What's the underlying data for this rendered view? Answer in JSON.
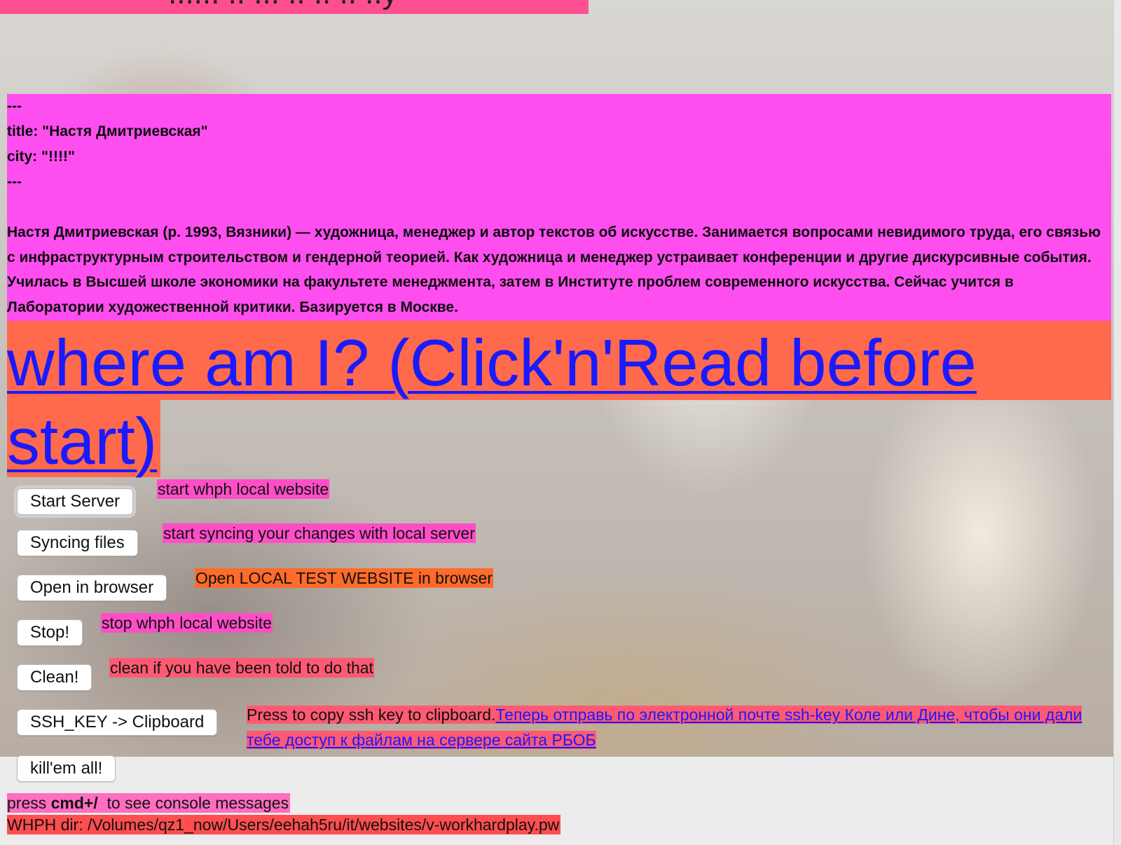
{
  "top_bar": {
    "partial_text": "...... .. ... .. .. .. ..y"
  },
  "frontmatter": {
    "separator_open": "---",
    "title_line": "title: \"Настя Дмитриевская\"",
    "city_line": "city: \"!!!!\"",
    "separator_close": "---",
    "bio": "Настя Дмитриевская (р. 1993, Вязники) — художница, менеджер и автор текстов об искусстве. Занимается вопросами невидимого труда, его связью с инфраструктурным строительством и гендерной теорией. Как художница и менеджер устраивает конференции и другие дискурсивные события. Училась в Высшей школе экономики на факультете менеджмента, затем в Институте проблем современного искусства. Сейчас учится в Лаборатории художественной критики. Базируется в Москве."
  },
  "headline": {
    "link_text": "where am I? (Click'n'Read before start)"
  },
  "actions": {
    "start_server": {
      "label": "Start Server",
      "description": "start whph local website"
    },
    "syncing_files": {
      "label": "Syncing files",
      "description": "start syncing your changes with local server"
    },
    "open_in_browser": {
      "label": "Open in browser",
      "description": "Open LOCAL TEST WEBSITE in browser"
    },
    "stop": {
      "label": "Stop!",
      "description": "stop whph local website"
    },
    "clean": {
      "label": "Clean!",
      "description": "clean if you have been told to do that"
    },
    "ssh_key": {
      "label": "SSH_KEY -> Clipboard",
      "description": "Press to copy ssh key to clipboard.",
      "link_text": "Теперь отправь по электронной почте ssh-key Коле или Дине, чтобы они дали тебе доступ к файлам на сервере сайта РБОБ"
    },
    "kill_all": {
      "label": "kill'em all!"
    }
  },
  "footer": {
    "hint_prefix": "press ",
    "hint_key": "cmd+/",
    "hint_suffix": "  to see console messages",
    "dir_label": "WHPH dir: /Volumes/qz1_now/Users/eehah5ru/it/websites/v-workhardplay.pw"
  },
  "colors": {
    "frontmatter_bg": "#ff4ef0",
    "headline_bg": "#ff6a4c",
    "link": "#1a1aff",
    "desc_pink": "#ff4ec8",
    "desc_orange": "#ff6b2a",
    "desc_rose": "#ff5a72",
    "dir_bg": "#ff4e50"
  }
}
